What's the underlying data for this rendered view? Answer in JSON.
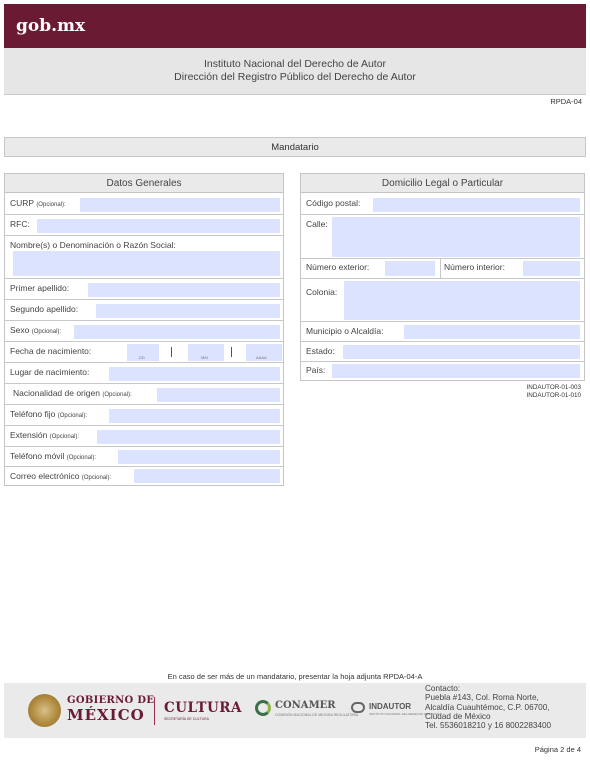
{
  "header": {
    "brand": "gob.mx"
  },
  "institute": {
    "line1": "Instituto Nacional del Derecho de Autor",
    "line2": "Dirección del Registro Público del Derecho de Autor"
  },
  "form_code": "RPDA-04",
  "section_title": "Mandatario",
  "left_panel": {
    "title": "Datos Generales",
    "fields": [
      {
        "label": "CURP",
        "note": "(Opcional):",
        "value": ""
      },
      {
        "label": "RFC:",
        "note": "",
        "value": ""
      },
      {
        "label": "Nombre(s) o Denominación o Razón Social:",
        "note": "",
        "value": ""
      },
      {
        "label": "Primer apellido:",
        "note": "",
        "value": ""
      },
      {
        "label": "Segundo apellido:",
        "note": "",
        "value": ""
      },
      {
        "label": "Sexo",
        "note": "(Opcional):",
        "value": ""
      },
      {
        "label": "Fecha de nacimiento:",
        "note": "",
        "value": ""
      },
      {
        "label": "Lugar de nacimiento:",
        "note": "",
        "value": ""
      },
      {
        "label": "Nacionalidad de origen",
        "note": "(Opcional):",
        "value": ""
      },
      {
        "label": "Teléfono fijo",
        "note": "(Opcional):",
        "value": ""
      },
      {
        "label": "Extensión",
        "note": "(Opcional):",
        "value": ""
      },
      {
        "label": "Teléfono móvil",
        "note": "(Opcional):",
        "value": ""
      },
      {
        "label": "Correo electrónico",
        "note": "(Opcional):",
        "value": ""
      }
    ],
    "date_hints": {
      "day": "DD",
      "month": "MM",
      "year": "AAAA"
    }
  },
  "right_panel": {
    "title": "Domicilio Legal o Particular",
    "fields": [
      {
        "label": "Código postal:",
        "value": ""
      },
      {
        "label": "Calle:",
        "value": ""
      },
      {
        "label": "Número exterior:",
        "value": ""
      },
      {
        "label": "Número interior:",
        "value": ""
      },
      {
        "label": "Colonia:",
        "value": ""
      },
      {
        "label": "Municipio o Alcaldía:",
        "value": ""
      },
      {
        "label": "Estado:",
        "value": ""
      },
      {
        "label": "País:",
        "value": ""
      }
    ],
    "codes": [
      "INDAUTOR-01-003",
      "INDAUTOR-01-010"
    ]
  },
  "note": "En caso de ser más de un mandatario, presentar la hoja adjunta RPDA-04-A",
  "footer": {
    "gob_line1": "GOBIERNO DE",
    "gob_line2": "MÉXICO",
    "cultura": "CULTURA",
    "cultura_sub": "SECRETARÍA DE CULTURA",
    "conamer": "CONAMER",
    "conamer_sub": "COMISIÓN NACIONAL DE MEJORA REGULATORIA",
    "indautor": "INDAUTOR",
    "indautor_sub": "INSTITUTO NACIONAL DEL DERECHO DE AUTOR",
    "contact": [
      "Contacto:",
      "Puebla #143, Col. Roma Norte,",
      "Alcaldía Cuauhtémoc, C.P. 06700,",
      "Ciudad de México",
      "Tel. 5536018210 y 16  8002283400"
    ]
  },
  "page_number": "Página 2 de 4",
  "colors": {
    "brand": "#6b1a33",
    "input_fill": "#dbe3ff",
    "band": "#eaeaea"
  }
}
